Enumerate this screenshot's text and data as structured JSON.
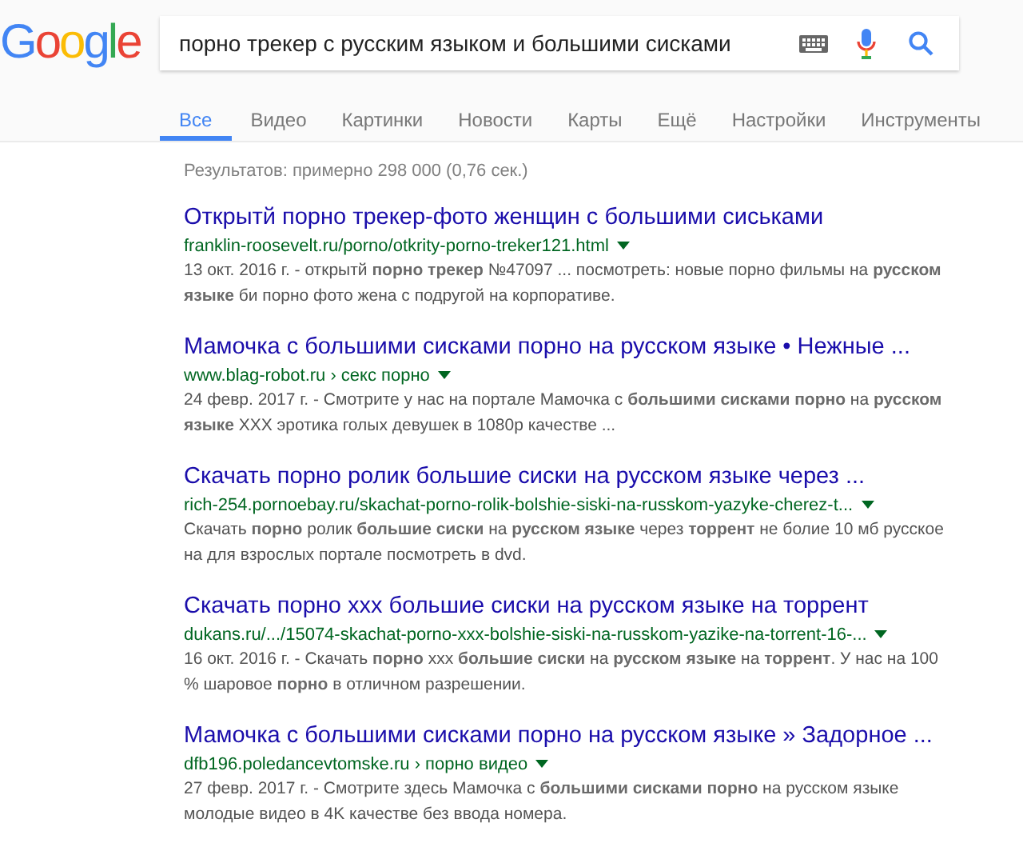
{
  "logo": {
    "letters": [
      {
        "char": "G",
        "color": "#4285f4"
      },
      {
        "char": "o",
        "color": "#ea4335"
      },
      {
        "char": "o",
        "color": "#fbbc05"
      },
      {
        "char": "g",
        "color": "#4285f4"
      },
      {
        "char": "l",
        "color": "#34a853"
      },
      {
        "char": "e",
        "color": "#ea4335"
      }
    ]
  },
  "search": {
    "value": "порно трекер с русским языком и большими сисками"
  },
  "tabs": [
    {
      "label": "Все",
      "selected": true
    },
    {
      "label": "Видео",
      "selected": false
    },
    {
      "label": "Картинки",
      "selected": false
    },
    {
      "label": "Новости",
      "selected": false
    },
    {
      "label": "Карты",
      "selected": false
    },
    {
      "label": "Ещё",
      "selected": false
    },
    {
      "label": "Настройки",
      "selected": false
    },
    {
      "label": "Инструменты",
      "selected": false
    }
  ],
  "stats": "Результатов: примерно 298 000 (0,76 сек.)",
  "results": [
    {
      "title": "Открытй порно трекер-фото женщин с большими сиськами",
      "url": "franklin-roosevelt.ru/porno/otkrity-porno-treker121.html",
      "snippet": "13 окт. 2016 г. - открытй **порно трекер** №47097 ... посмотреть: новые порно фильмы на **русском языке** би порно фото жена с подругой на корпоративе."
    },
    {
      "title": "Мамочка с большими сисками порно на русском языке • Нежные ...",
      "url": "www.blag-robot.ru › секс порно",
      "snippet": "24 февр. 2017 г. - Смотрите у нас на портале Мамочка с **большими сисками порно** на **русском языке** XXX эротика голых девушек в 1080p качестве ..."
    },
    {
      "title": "Скачать порно ролик большие сиски на русском языке через ...",
      "url": "rich-254.pornoebay.ru/skachat-porno-rolik-bolshie-siski-na-russkom-yazyke-cherez-t...",
      "snippet": "Скачать **порно** ролик **большие сиски** на **русском языке** через **торрент** не болие 10 мб русское на для взрослых портале посмотреть в dvd."
    },
    {
      "title": "Скачать порно xxx большие сиски на русском языке на торрент",
      "url": "dukans.ru/.../15074-skachat-porno-xxx-bolshie-siski-na-russkom-yazike-na-torrent-16-...",
      "snippet": "16 окт. 2016 г. - Скачать **порно** xxx **большие сиски** на **русском языке** на **торрент**. У нас на 100 % шаровое **порно** в отличном разрешении."
    },
    {
      "title": "Мамочка с большими сисками порно на русском языке » Задорное ...",
      "url": "dfb196.poledancevtomske.ru › порно видео",
      "snippet": "27 февр. 2017 г. - Смотрите здесь Мамочка с **большими сисками порно** на русском языке молодые видео в 4K качестве без ввода номера."
    }
  ]
}
